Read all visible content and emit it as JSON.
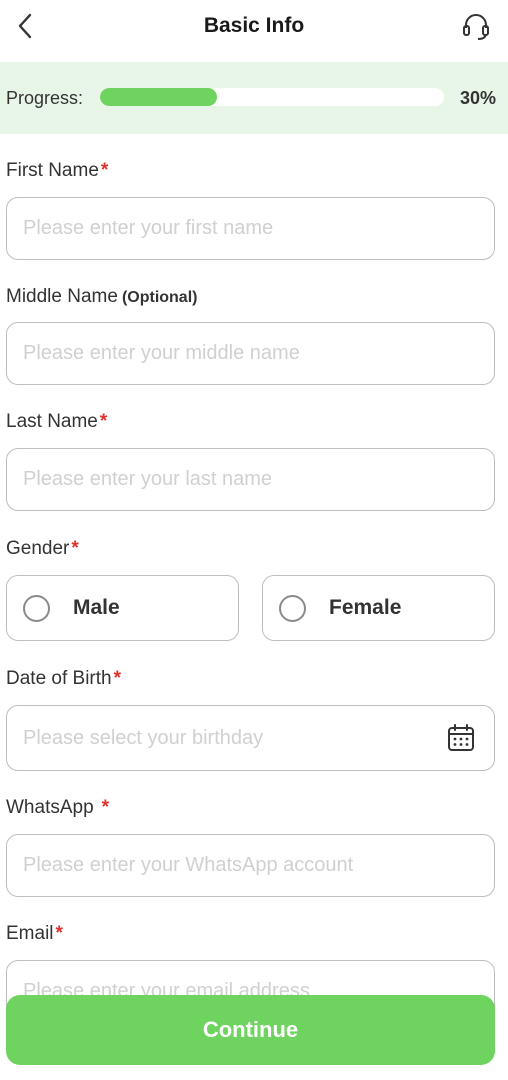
{
  "header": {
    "title": "Basic Info"
  },
  "progress": {
    "label": "Progress:",
    "value_text": "30%",
    "fill_fraction": 0.34
  },
  "form": {
    "first_name": {
      "label": "First Name",
      "required": "*",
      "placeholder": "Please enter your first name"
    },
    "middle_name": {
      "label": "Middle Name",
      "optional": "(Optional)",
      "placeholder": "Please enter your middle name"
    },
    "last_name": {
      "label": "Last Name",
      "required": "*",
      "placeholder": "Please enter your last name"
    },
    "gender": {
      "label": "Gender",
      "required": "*",
      "options": [
        "Male",
        "Female"
      ]
    },
    "dob": {
      "label": "Date of Birth",
      "required": "*",
      "placeholder": "Please select your birthday"
    },
    "whatsapp": {
      "label": "WhatsApp",
      "required": "*",
      "placeholder": "Please enter your WhatsApp account"
    },
    "email": {
      "label": "Email",
      "required": "*",
      "placeholder": "Please enter your email address"
    }
  },
  "footer": {
    "continue_label": "Continue"
  },
  "colors": {
    "accent": "#6fd35f",
    "progress_band": "#e8f6e7",
    "required": "#e0312b"
  },
  "icons": {
    "back": "chevron-left-icon",
    "support": "headset-icon",
    "calendar": "calendar-icon"
  }
}
